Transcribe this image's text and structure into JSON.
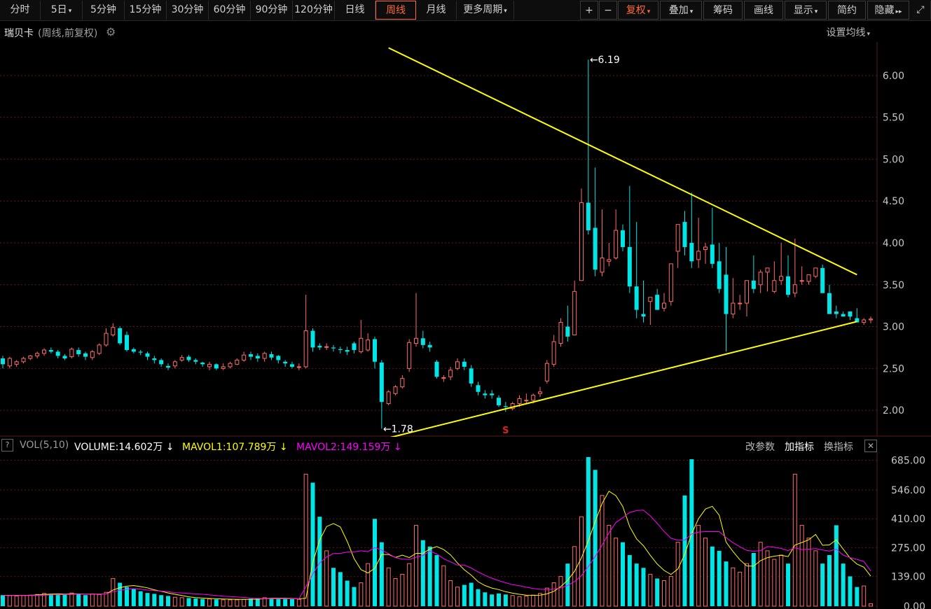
{
  "toolbar": {
    "periods": [
      "分时",
      "5日",
      "5分钟",
      "15分钟",
      "30分钟",
      "60分钟",
      "90分钟",
      "120分钟",
      "日线",
      "周线",
      "月线",
      "更多周期"
    ],
    "active_period": "周线",
    "plus": "+",
    "minus": "−",
    "adjust": "复权",
    "overlay": "叠加",
    "chips": "筹码",
    "draw": "画线",
    "display": "显示",
    "simple": "简约",
    "hide": "隐藏",
    "accent_color": "#ff6a3c"
  },
  "header": {
    "stock_name": "瑞贝卡",
    "meta": "(周线,前复权)",
    "gear_icon": "gear-icon",
    "ma_setting": "设置均线"
  },
  "chart_data": [
    {
      "type": "candlestick",
      "title": "瑞贝卡 (周线,前复权)",
      "ylim": [
        1.7,
        6.4
      ],
      "y_ticks": [
        "6.00",
        "5.50",
        "5.00",
        "4.50",
        "4.00",
        "3.50",
        "3.00",
        "2.50",
        "2.00"
      ],
      "grid": true,
      "annotations": [
        {
          "text": "6.19",
          "value": 6.19,
          "bar_index": 85
        },
        {
          "text": "1.78",
          "value": 1.78,
          "bar_index": 55
        }
      ],
      "marker": {
        "text": "S",
        "bar_index": 73,
        "color": "#e02020"
      },
      "trendlines": [
        {
          "from": [
            56,
            6.33
          ],
          "to": [
            124,
            3.62
          ],
          "color": "#ffff00"
        },
        {
          "from": [
            56,
            1.67
          ],
          "to": [
            124,
            3.06
          ],
          "color": "#ffff00"
        }
      ],
      "up_color": "#ff6b6b",
      "down_color": "#00e5e5",
      "series": [
        {
          "name": "open",
          "values": [
            2.62,
            2.53,
            2.55,
            2.58,
            2.62,
            2.65,
            2.68,
            2.72,
            2.7,
            2.65,
            2.64,
            2.72,
            2.68,
            2.63,
            2.68,
            2.78,
            2.9,
            2.98,
            2.9,
            2.73,
            2.7,
            2.68,
            2.62,
            2.6,
            2.53,
            2.53,
            2.6,
            2.64,
            2.6,
            2.57,
            2.52,
            2.55,
            2.5,
            2.52,
            2.55,
            2.6,
            2.67,
            2.65,
            2.62,
            2.67,
            2.65,
            2.58,
            2.55,
            2.52,
            2.52,
            2.95,
            2.77,
            2.76,
            2.75,
            2.73,
            2.72,
            2.8,
            2.7,
            2.72,
            2.85,
            2.57,
            2.08,
            2.2,
            2.28,
            2.5,
            2.8,
            2.86,
            2.78,
            2.58,
            2.38,
            2.4,
            2.5,
            2.58,
            2.5,
            2.3,
            2.2,
            2.2,
            2.15,
            2.05,
            2.02,
            2.08,
            2.12,
            2.12,
            2.2,
            2.35,
            2.55,
            2.8,
            3.0,
            2.9,
            3.55,
            4.48,
            4.18,
            3.65,
            3.78,
            3.82,
            4.15,
            3.95,
            3.48,
            3.15,
            3.3,
            3.38,
            3.22,
            3.3,
            3.9,
            4.25,
            4.0,
            3.8,
            3.92,
            3.98,
            3.78,
            3.62,
            3.15,
            3.28,
            3.28,
            3.55,
            3.5,
            3.65,
            3.42,
            3.55,
            3.6,
            3.4,
            3.55,
            3.54,
            3.6,
            3.7,
            3.4,
            3.18,
            3.15,
            3.18,
            3.1,
            3.05,
            3.08
          ],
          "color": "#ff6b6b"
        },
        {
          "name": "close",
          "values": [
            2.55,
            2.62,
            2.58,
            2.62,
            2.65,
            2.68,
            2.72,
            2.7,
            2.65,
            2.62,
            2.73,
            2.67,
            2.64,
            2.7,
            2.78,
            2.92,
            2.99,
            2.8,
            2.72,
            2.7,
            2.69,
            2.64,
            2.6,
            2.55,
            2.51,
            2.58,
            2.63,
            2.6,
            2.58,
            2.55,
            2.55,
            2.5,
            2.52,
            2.56,
            2.6,
            2.66,
            2.64,
            2.62,
            2.68,
            2.63,
            2.6,
            2.56,
            2.52,
            2.52,
            2.95,
            2.75,
            2.75,
            2.76,
            2.74,
            2.72,
            2.7,
            2.72,
            2.86,
            2.84,
            2.58,
            2.1,
            2.22,
            2.28,
            2.38,
            2.81,
            2.86,
            2.78,
            2.75,
            2.4,
            2.39,
            2.48,
            2.58,
            2.52,
            2.32,
            2.22,
            2.18,
            2.18,
            2.06,
            2.04,
            2.08,
            2.14,
            2.12,
            2.18,
            2.22,
            2.56,
            2.82,
            3.05,
            2.88,
            3.42,
            4.48,
            4.15,
            3.68,
            3.82,
            3.8,
            4.15,
            3.95,
            3.48,
            3.2,
            3.12,
            3.35,
            3.2,
            3.28,
            3.75,
            4.22,
            3.95,
            3.78,
            3.9,
            3.95,
            3.75,
            3.45,
            3.15,
            3.28,
            3.28,
            3.55,
            3.45,
            3.65,
            3.7,
            3.55,
            3.6,
            3.38,
            3.5,
            3.55,
            3.62,
            3.7,
            3.4,
            3.15,
            3.15,
            3.12,
            3.12,
            3.05,
            3.08,
            3.09
          ],
          "color": "#00e5e5"
        },
        {
          "name": "high",
          "values": [
            2.65,
            2.64,
            2.6,
            2.64,
            2.66,
            2.7,
            2.74,
            2.75,
            2.72,
            2.67,
            2.75,
            2.75,
            2.7,
            2.72,
            2.8,
            2.98,
            3.04,
            3.0,
            2.94,
            2.75,
            2.72,
            2.7,
            2.65,
            2.62,
            2.56,
            2.6,
            2.66,
            2.66,
            2.62,
            2.58,
            2.58,
            2.56,
            2.56,
            2.58,
            2.62,
            2.7,
            2.7,
            2.68,
            2.7,
            2.7,
            2.66,
            2.6,
            2.58,
            2.56,
            3.38,
            2.98,
            2.8,
            2.8,
            2.78,
            2.76,
            2.76,
            2.82,
            3.08,
            2.92,
            2.88,
            2.6,
            2.24,
            2.3,
            2.42,
            2.85,
            3.4,
            2.95,
            2.82,
            2.6,
            2.42,
            2.52,
            2.62,
            2.62,
            2.54,
            2.34,
            2.24,
            2.24,
            2.18,
            2.1,
            2.1,
            2.18,
            2.2,
            2.2,
            2.28,
            2.6,
            2.9,
            3.1,
            3.25,
            3.55,
            4.65,
            6.19,
            4.9,
            4.4,
            4.0,
            4.4,
            4.22,
            4.68,
            4.25,
            3.55,
            3.35,
            3.45,
            3.4,
            3.45,
            4.0,
            4.38,
            4.6,
            4.3,
            4.0,
            4.42,
            4.0,
            3.95,
            3.58,
            3.38,
            3.4,
            3.85,
            3.68,
            3.68,
            3.78,
            4.0,
            3.85,
            4.05,
            3.72,
            3.58,
            3.64,
            3.74,
            3.5,
            3.25,
            3.18,
            3.18,
            3.22,
            3.1,
            3.12
          ],
          "color": "#ffffff"
        },
        {
          "name": "low",
          "values": [
            2.5,
            2.5,
            2.52,
            2.56,
            2.6,
            2.62,
            2.65,
            2.68,
            2.62,
            2.6,
            2.62,
            2.64,
            2.6,
            2.6,
            2.66,
            2.76,
            2.88,
            2.78,
            2.7,
            2.68,
            2.66,
            2.6,
            2.56,
            2.52,
            2.48,
            2.5,
            2.58,
            2.58,
            2.55,
            2.52,
            2.48,
            2.48,
            2.48,
            2.5,
            2.54,
            2.58,
            2.6,
            2.58,
            2.58,
            2.6,
            2.56,
            2.52,
            2.5,
            2.48,
            2.5,
            2.7,
            2.72,
            2.72,
            2.7,
            2.68,
            2.66,
            2.68,
            2.68,
            2.7,
            2.5,
            1.78,
            2.06,
            2.18,
            2.26,
            2.46,
            2.76,
            2.74,
            2.7,
            2.38,
            2.34,
            2.36,
            2.48,
            2.48,
            2.28,
            2.18,
            2.14,
            2.14,
            2.04,
            1.98,
            2.0,
            2.04,
            2.08,
            2.08,
            2.16,
            2.32,
            2.52,
            2.76,
            2.82,
            2.9,
            3.55,
            4.1,
            3.6,
            3.6,
            3.72,
            3.8,
            3.9,
            3.4,
            3.1,
            3.05,
            3.02,
            3.2,
            3.18,
            3.25,
            3.7,
            3.85,
            3.7,
            3.7,
            3.75,
            3.7,
            3.4,
            2.7,
            3.1,
            3.2,
            3.12,
            3.4,
            3.4,
            3.42,
            3.4,
            3.5,
            3.35,
            3.35,
            3.5,
            3.5,
            3.58,
            3.65,
            3.35,
            3.1,
            3.12,
            3.08,
            3.08,
            3.02,
            3.04
          ],
          "color": "#ffffff"
        }
      ]
    },
    {
      "type": "bar",
      "title": "VOL(5,10)",
      "ylim": [
        0,
        700
      ],
      "y_ticks": [
        "685.00",
        "546.00",
        "410.00",
        "275.00",
        "139.00",
        "0.00"
      ],
      "grid": true,
      "series": [
        {
          "name": "VOLUME",
          "values": [
            52,
            50,
            48,
            50,
            52,
            55,
            60,
            58,
            55,
            56,
            62,
            58,
            52,
            58,
            55,
            65,
            130,
            110,
            90,
            82,
            70,
            62,
            58,
            52,
            48,
            42,
            40,
            38,
            36,
            34,
            34,
            32,
            30,
            30,
            30,
            32,
            35,
            38,
            40,
            38,
            36,
            34,
            33,
            32,
            620,
            580,
            420,
            260,
            180,
            160,
            120,
            90,
            110,
            200,
            410,
            300,
            180,
            130,
            150,
            200,
            380,
            310,
            280,
            240,
            190,
            120,
            90,
            100,
            110,
            80,
            65,
            55,
            60,
            55,
            50,
            45,
            48,
            52,
            60,
            85,
            110,
            140,
            200,
            280,
            420,
            700,
            640,
            520,
            380,
            320,
            300,
            240,
            200,
            180,
            150,
            130,
            120,
            140,
            300,
            520,
            690,
            380,
            320,
            280,
            260,
            210,
            180,
            160,
            200,
            250,
            300,
            260,
            220,
            240,
            200,
            620,
            380,
            320,
            260,
            200,
            240,
            380,
            200,
            140,
            90,
            95,
            12
          ],
          "up_color": "#ff6b6b",
          "down_color": "#00e5e5"
        },
        {
          "name": "MAVOL1",
          "color": "#ffff00",
          "values": [
            51,
            51,
            51,
            51,
            51,
            53,
            55,
            57,
            58,
            57,
            58,
            58,
            57,
            57,
            57,
            58,
            76,
            87,
            94,
            97,
            92,
            86,
            77,
            70,
            62,
            56,
            50,
            44,
            40,
            38,
            36,
            35,
            34,
            33,
            32,
            32,
            32,
            33,
            35,
            37,
            37,
            37,
            36,
            35,
            37,
            205,
            310,
            374,
            388,
            372,
            304,
            223,
            172,
            156,
            178,
            243,
            243,
            229,
            240,
            228,
            248,
            248,
            269,
            280,
            266,
            241,
            203,
            171,
            146,
            115,
            97,
            85,
            78,
            68,
            61,
            56,
            52,
            51,
            52,
            58,
            70,
            92,
            122,
            164,
            227,
            307,
            398,
            482,
            540,
            519,
            468,
            374,
            316,
            284,
            239,
            198,
            168,
            149,
            175,
            244,
            340,
            411,
            456,
            469,
            427,
            301,
            257,
            218,
            189,
            188,
            214,
            228,
            235,
            239,
            233,
            287,
            299,
            312,
            337,
            286,
            288,
            312,
            268,
            226,
            198,
            183,
            141
          ],
          "draw_only": true
        },
        {
          "name": "MAVOL2",
          "color": "#ff00ff",
          "values": [
            50,
            50,
            50,
            50,
            50,
            51,
            52,
            53,
            54,
            55,
            56,
            57,
            57,
            57,
            57,
            58,
            68,
            75,
            80,
            82,
            80,
            76,
            73,
            71,
            68,
            63,
            62,
            60,
            58,
            56,
            53,
            50,
            47,
            45,
            43,
            41,
            38,
            36,
            35,
            35,
            35,
            35,
            35,
            35,
            92,
            151,
            203,
            231,
            247,
            248,
            254,
            255,
            260,
            256,
            275,
            264,
            246,
            228,
            221,
            220,
            230,
            238,
            259,
            245,
            223,
            208,
            193,
            193,
            179,
            161,
            145,
            131,
            120,
            110,
            101,
            96,
            89,
            83,
            80,
            78,
            80,
            86,
            97,
            116,
            143,
            186,
            234,
            287,
            344,
            393,
            415,
            440,
            449,
            451,
            424,
            389,
            351,
            319,
            310,
            310,
            339,
            348,
            350,
            350,
            350,
            322,
            298,
            279,
            262,
            258,
            261,
            280,
            277,
            271,
            261,
            274,
            266,
            268,
            270,
            264,
            259,
            268,
            240,
            228,
            220,
            210,
            165
          ],
          "draw_only": true
        }
      ]
    }
  ],
  "vol_header": {
    "help": "?",
    "vol_label": "VOL(5,10)",
    "volume_label": "VOLUME:14.602万",
    "volume_arrow": "↓",
    "mavol1_label": "MAVOL1:107.789万",
    "mavol1_arrow": "↓",
    "mavol2_label": "MAVOL2:149.159万",
    "mavol2_arrow": "↓",
    "change_params": "改参数",
    "add_indicator": "加指标",
    "switch_indicator": "换指标",
    "close": "✕"
  }
}
